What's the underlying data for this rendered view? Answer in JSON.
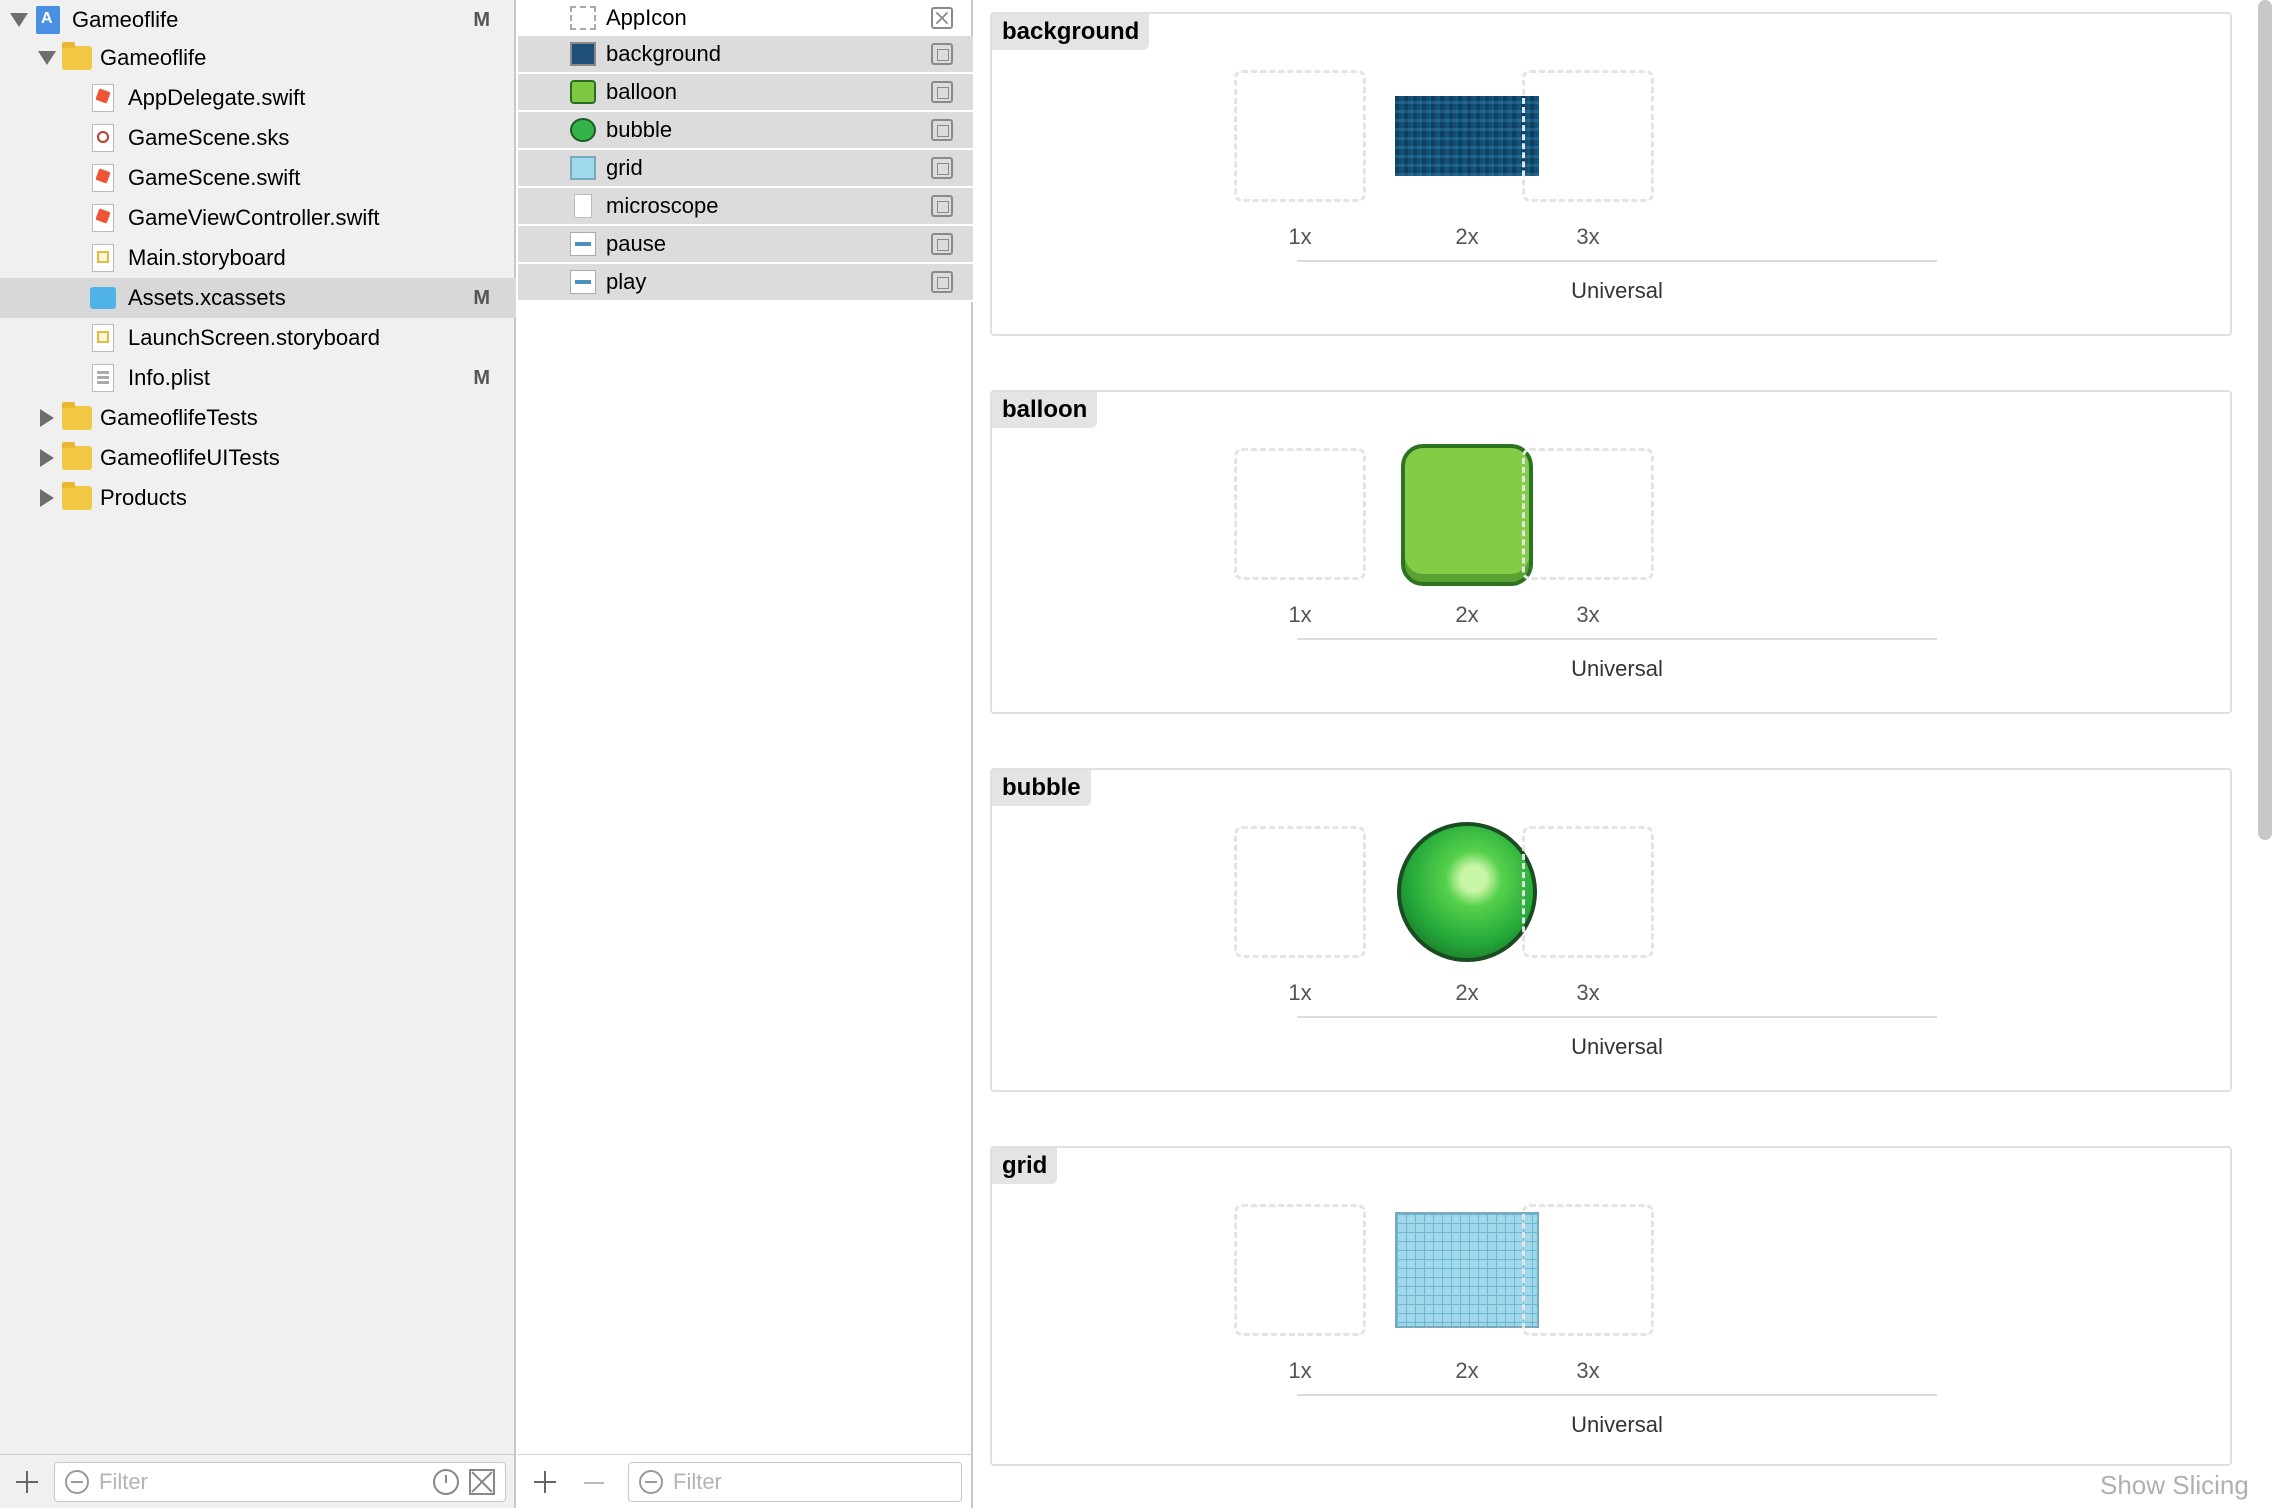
{
  "navigator": {
    "items": [
      {
        "label": "Gameoflife",
        "badge": "M"
      },
      {
        "label": "Gameoflife",
        "badge": ""
      },
      {
        "label": "AppDelegate.swift",
        "badge": ""
      },
      {
        "label": "GameScene.sks",
        "badge": ""
      },
      {
        "label": "GameScene.swift",
        "badge": ""
      },
      {
        "label": "GameViewController.swift",
        "badge": ""
      },
      {
        "label": "Main.storyboard",
        "badge": ""
      },
      {
        "label": "Assets.xcassets",
        "badge": "M"
      },
      {
        "label": "LaunchScreen.storyboard",
        "badge": ""
      },
      {
        "label": "Info.plist",
        "badge": "M"
      },
      {
        "label": "GameoflifeTests",
        "badge": ""
      },
      {
        "label": "GameoflifeUITests",
        "badge": ""
      },
      {
        "label": "Products",
        "badge": ""
      }
    ],
    "selected": "Assets.xcassets",
    "filter_placeholder": "Filter"
  },
  "asset_list": {
    "items": [
      {
        "label": "AppIcon",
        "icon": "app-icon-placeholder"
      },
      {
        "label": "background",
        "icon": "image-icon"
      },
      {
        "label": "balloon",
        "icon": "image-icon"
      },
      {
        "label": "bubble",
        "icon": "image-icon"
      },
      {
        "label": "grid",
        "icon": "image-icon"
      },
      {
        "label": "microscope",
        "icon": "image-icon"
      },
      {
        "label": "pause",
        "icon": "image-icon"
      },
      {
        "label": "play",
        "icon": "image-icon"
      }
    ],
    "filter_placeholder": "Filter"
  },
  "editor": {
    "sets": [
      {
        "title": "background",
        "scale_1x": "1x",
        "scale_2x": "2x",
        "scale_3x": "3x",
        "idiom": "Universal"
      },
      {
        "title": "balloon",
        "scale_1x": "1x",
        "scale_2x": "2x",
        "scale_3x": "3x",
        "idiom": "Universal"
      },
      {
        "title": "bubble",
        "scale_1x": "1x",
        "scale_2x": "2x",
        "scale_3x": "3x",
        "idiom": "Universal"
      },
      {
        "title": "grid",
        "scale_1x": "1x",
        "scale_2x": "2x",
        "scale_3x": "3x",
        "idiom": "Universal"
      }
    ],
    "show_slicing": "Show Slicing"
  }
}
